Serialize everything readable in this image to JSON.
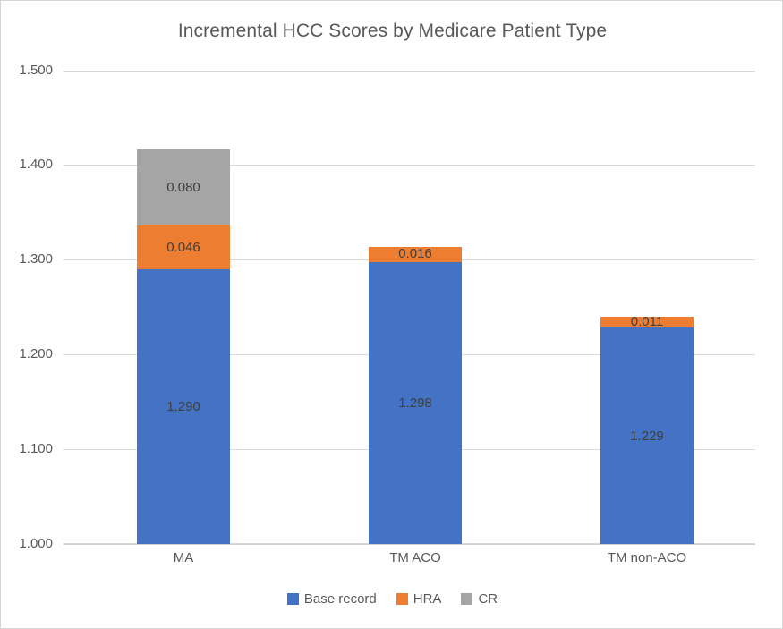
{
  "chart_data": {
    "type": "bar",
    "subtype": "stacked-column",
    "title": "Incremental HCC Scores by Medicare Patient Type",
    "subtitle": "",
    "xlabel": "",
    "ylabel": "",
    "categories": [
      "MA",
      "TM ACO",
      "TM non-ACO"
    ],
    "series": [
      {
        "name": "Base record",
        "color": "#4472C4",
        "values": [
          1.29,
          1.298,
          1.229
        ],
        "labels": [
          "1.290",
          "1.298",
          "1.229"
        ]
      },
      {
        "name": "HRA",
        "color": "#ED7D31",
        "values": [
          0.046,
          0.016,
          0.011
        ],
        "labels": [
          "0.046",
          "0.016",
          "0.011"
        ]
      },
      {
        "name": "CR",
        "color": "#A5A5A5",
        "values": [
          0.08,
          0.0,
          0.0
        ],
        "labels": [
          "0.080",
          "",
          ""
        ]
      }
    ],
    "totals": [
      1.416,
      1.314,
      1.24
    ],
    "ylim": [
      1.0,
      1.5
    ],
    "ytick_step": 0.1,
    "ytick_labels": [
      "1.500",
      "1.400",
      "1.300",
      "1.200",
      "1.100",
      "1.000"
    ],
    "ytick_values": [
      1.5,
      1.4,
      1.3,
      1.2,
      1.1,
      1.0
    ],
    "grid": true,
    "grid_color": "#D9D9D9",
    "legend_position": "bottom",
    "legend": [
      "Base record",
      "HRA",
      "CR"
    ],
    "annotations": []
  },
  "colors": {
    "base_record": "#4472C4",
    "hra": "#ED7D31",
    "cr": "#A5A5A5",
    "text": "#595959",
    "grid": "#D9D9D9",
    "border": "#D6D6D6",
    "background": "#FFFFFF"
  },
  "labels": {
    "y": {
      "t0": "1.500",
      "t1": "1.400",
      "t2": "1.300",
      "t3": "1.200",
      "t4": "1.100",
      "t5": "1.000"
    },
    "x": {
      "c0": "MA",
      "c1": "TM ACO",
      "c2": "TM non-ACO"
    },
    "legend": {
      "s0": "Base record",
      "s1": "HRA",
      "s2": "CR"
    },
    "values": {
      "b0_base": "1.290",
      "b0_hra": "0.046",
      "b0_cr": "0.080",
      "b1_base": "1.298",
      "b1_hra": "0.016",
      "b2_base": "1.229",
      "b2_hra": "0.011"
    }
  }
}
